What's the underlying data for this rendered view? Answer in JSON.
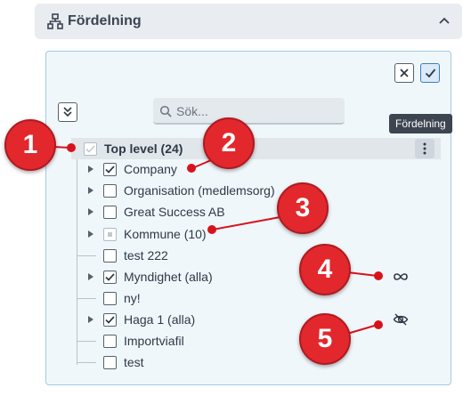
{
  "header": {
    "title": "Fördelning",
    "icon": "hierarchy-icon",
    "chevron": "chevron-up-icon"
  },
  "toolbar": {
    "cancel_icon": "close-icon",
    "ok_icon": "check-icon",
    "collapse_icon": "collapse-all-icon"
  },
  "search": {
    "placeholder": "Sök..."
  },
  "tooltip": {
    "text": "Fördelning"
  },
  "tree": {
    "top": {
      "label": "Top level (24)",
      "checkbox": "checked-disabled",
      "menu_icon": "more-vertical-icon"
    },
    "items": [
      {
        "label": "Company",
        "expandable": true,
        "checked": true
      },
      {
        "label": "Organisation (medlemsorg)",
        "expandable": true,
        "checked": false
      },
      {
        "label": "Great Success AB",
        "expandable": true,
        "checked": false
      },
      {
        "label": "Kommune (10)",
        "expandable": true,
        "checked": "indeterminate"
      },
      {
        "label": "test 222",
        "expandable": false,
        "checked": false
      },
      {
        "label": "Myndighet (alla)",
        "expandable": true,
        "checked": true,
        "side_icon": "infinity-icon"
      },
      {
        "label": "ny!",
        "expandable": false,
        "checked": false
      },
      {
        "label": "Haga 1 (alla)",
        "expandable": true,
        "checked": true,
        "side_icon": "eye-off-icon"
      },
      {
        "label": "Importviafil",
        "expandable": false,
        "checked": false
      },
      {
        "label": "test",
        "expandable": false,
        "checked": false
      }
    ]
  },
  "annotations": [
    {
      "number": "1"
    },
    {
      "number": "2"
    },
    {
      "number": "3"
    },
    {
      "number": "4"
    },
    {
      "number": "5"
    }
  ],
  "colors": {
    "annotation": "#e2282d",
    "accent": "#3a7cc5",
    "panel_border": "#9fcde2"
  }
}
